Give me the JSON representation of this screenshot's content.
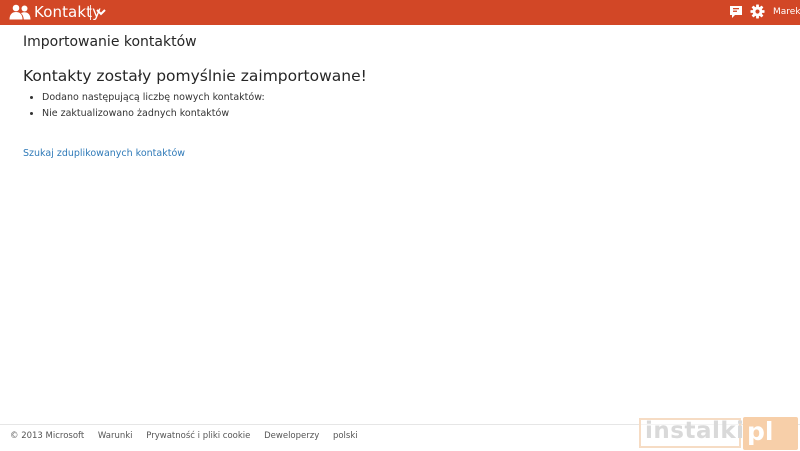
{
  "header": {
    "app_title": "Kontakty",
    "user_name": "Marek",
    "app_icon": "people-icon",
    "switcher_icon": "chevron-down-icon",
    "chat_icon": "chat-icon",
    "settings_icon": "gear-icon",
    "brand_color": "#d24726"
  },
  "main": {
    "page_title": "Importowanie kontaktów",
    "success_message": "Kontakty zostały pomyślnie zaimportowane!",
    "results": [
      "Dodano następującą liczbę nowych kontaktów:",
      "Nie zaktualizowano żadnych kontaktów"
    ],
    "duplicates_link": "Szukaj zduplikowanych kontaktów",
    "link_color": "#2f7ab8"
  },
  "footer": {
    "copyright": "© 2013 Microsoft",
    "links": [
      "Warunki",
      "Prywatność i pliki cookie",
      "Deweloperzy",
      "polski"
    ]
  },
  "watermark": {
    "text": "instalki",
    "suffix": "pl"
  }
}
